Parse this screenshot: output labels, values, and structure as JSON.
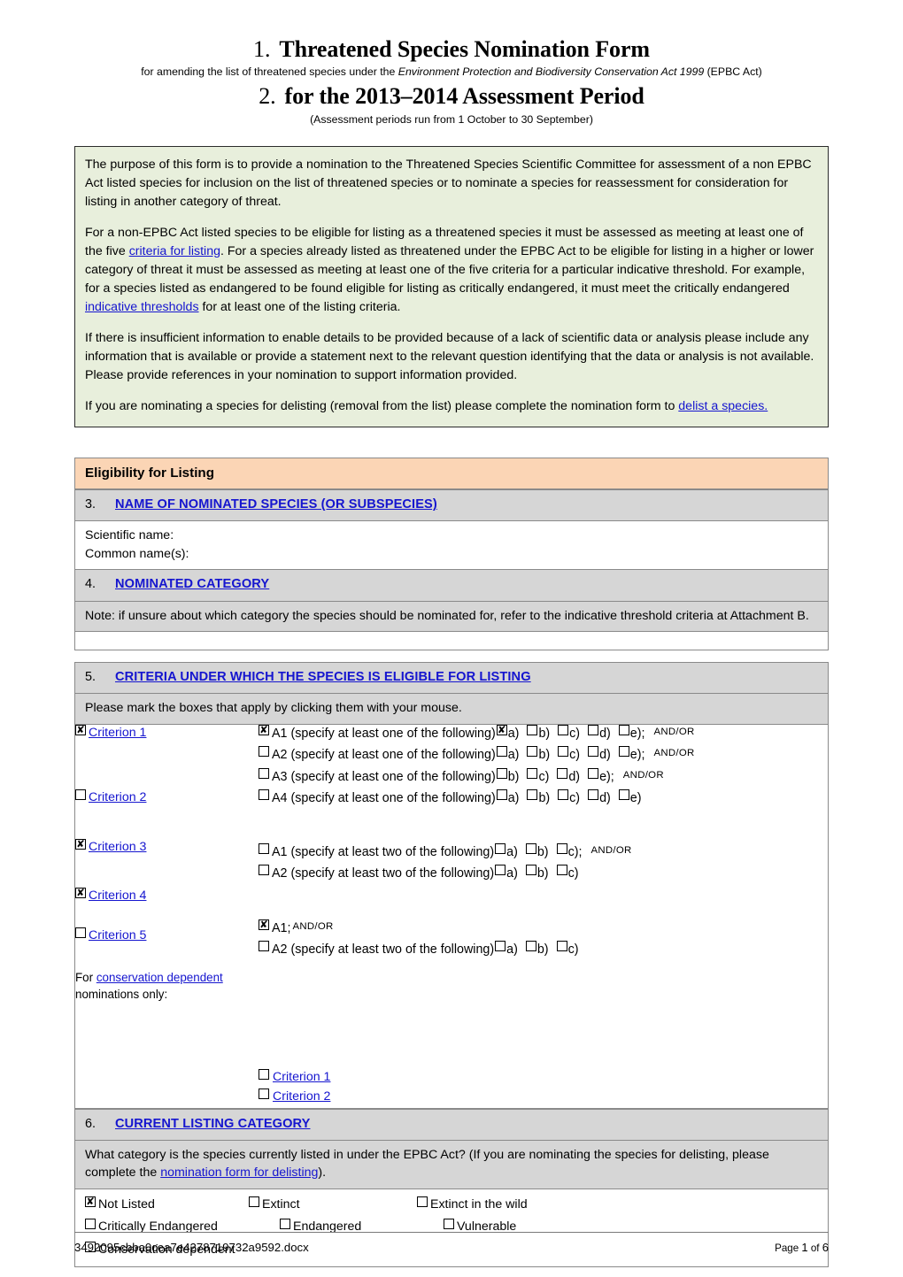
{
  "document": {
    "title_1_number": "1.",
    "title_1": "Threatened Species Nomination Form",
    "subtitle_1_pre": "for amending the list of threatened species under the ",
    "subtitle_1_italic": "Environment Protection and Biodiversity Conservation Act 1999",
    "subtitle_1_post": " (EPBC Act)",
    "title_2_number": "2.",
    "title_2": "for the 2013–2014 Assessment Period",
    "subtitle_2": "(Assessment periods run from 1 October to 30 September)"
  },
  "intro": {
    "para1": "The purpose of this form is to provide a nomination to the Threatened Species Scientific Committee for assessment of a non EPBC Act listed species for inclusion on the list of threatened species or to nominate a species for reassessment for consideration for listing in another category of threat.",
    "para2_a": "For a non-EPBC Act listed species to be eligible for listing as a threatened species it must be assessed as meeting at least one of the five ",
    "para2_link1": "criteria for listing",
    "para2_b": ". For a species already listed as threatened under the EPBC Act to be eligible for listing in a higher or lower category of threat it must be assessed as meeting at least one of the five criteria for a particular indicative threshold. For example, for a species listed as endangered to be found eligible for listing as critically endangered, it must meet the critically endangered ",
    "para2_link2": "indicative thresholds",
    "para2_c": " for at least one of the listing criteria.",
    "para3": "If there is insufficient information to enable details to be provided because of a lack of scientific data or analysis please include any information that is available or provide a statement next to the relevant question identifying that the data or analysis is not available. Please provide references in your nomination to support information provided.",
    "para4_a": "If you are nominating a species for delisting (removal from the list) please complete the nomination form to ",
    "para4_link": "delist a species.",
    "background_color": "#E8EFDC"
  },
  "eligibility_header": {
    "label": "Eligibility for Listing",
    "background_color": "#FBD5B5"
  },
  "section3": {
    "number": "3.",
    "heading": "NAME OF NOMINATED SPECIES (OR SUBSPECIES)",
    "field_scientific_name": "Scientific name:",
    "field_common_name": "Common name(s):",
    "scientific_name_value": "",
    "common_name_value": ""
  },
  "section4": {
    "number": "4.",
    "heading": "NOMINATED CATEGORY",
    "note": "Note: if unsure about which category the species should be nominated for, refer to the indicative threshold criteria at Attachment B."
  },
  "section5": {
    "number": "5.",
    "heading": "CRITERIA UNDER WHICH THE SPECIES IS ELIGIBLE FOR LISTING",
    "instruction": "Please mark the boxes that apply by clicking them with your mouse.",
    "criteria": [
      {
        "label": "Criterion 1",
        "checked": true,
        "rows": [
          {
            "checked": true,
            "text": "A1 (specify at least one of the following)",
            "subs": [
              {
                "label": "a)",
                "checked": true
              },
              {
                "label": "b)",
                "checked": false
              },
              {
                "label": "c)",
                "checked": false
              },
              {
                "label": "d)",
                "checked": false
              },
              {
                "label": "e);",
                "checked": false
              }
            ],
            "suffix": "AND/OR"
          },
          {
            "checked": false,
            "text": "A2 (specify at least one of the following)",
            "subs": [
              {
                "label": "a)",
                "checked": false
              },
              {
                "label": "b)",
                "checked": false
              },
              {
                "label": "c)",
                "checked": false
              },
              {
                "label": "d)",
                "checked": false
              },
              {
                "label": "e);",
                "checked": false
              }
            ],
            "suffix": "AND/OR"
          },
          {
            "checked": false,
            "text": "A3 (specify at least one of the following)",
            "subs": [
              {
                "label": "b)",
                "checked": false
              },
              {
                "label": "c)",
                "checked": false
              },
              {
                "label": "d)",
                "checked": false
              },
              {
                "label": "e);",
                "checked": false
              }
            ],
            "suffix": "AND/OR"
          },
          {
            "checked": false,
            "text": "A4 (specify at least one of the following)",
            "subs": [
              {
                "label": "a)",
                "checked": false
              },
              {
                "label": "b)",
                "checked": false
              },
              {
                "label": "c)",
                "checked": false
              },
              {
                "label": "d)",
                "checked": false
              },
              {
                "label": "e)",
                "checked": false
              }
            ],
            "suffix": ""
          }
        ]
      },
      {
        "label": "Criterion 2",
        "checked": false,
        "rows": [
          {
            "checked": false,
            "text": "A1 (specify at least two of the following)",
            "subs": [
              {
                "label": "a)",
                "checked": false
              },
              {
                "label": "b)",
                "checked": false
              },
              {
                "label": "c);",
                "checked": false
              }
            ],
            "suffix": "AND/OR"
          },
          {
            "checked": false,
            "text": "A2 (specify at least two of the following)",
            "subs": [
              {
                "label": "a)",
                "checked": false
              },
              {
                "label": "b)",
                "checked": false
              },
              {
                "label": "c)",
                "checked": false
              }
            ],
            "suffix": ""
          }
        ]
      },
      {
        "label": "Criterion 3",
        "checked": true,
        "rows": [
          {
            "checked": true,
            "text": "A1;",
            "subs": [],
            "suffix": "AND/OR"
          },
          {
            "checked": false,
            "text": "A2 (specify at least two of the following)",
            "subs": [
              {
                "label": "a)",
                "checked": false
              },
              {
                "label": "b)",
                "checked": false
              },
              {
                "label": "c)",
                "checked": false
              }
            ],
            "suffix": ""
          }
        ]
      },
      {
        "label": "Criterion 4",
        "checked": true,
        "rows": []
      },
      {
        "label": "Criterion 5",
        "checked": false,
        "rows": []
      }
    ],
    "conservation_dependent": {
      "prefix": "For ",
      "link": "conservation dependent",
      "suffix": " nominations only:",
      "options": [
        {
          "label": "Criterion 1",
          "checked": false
        },
        {
          "label": "Criterion 2",
          "checked": false
        }
      ]
    }
  },
  "section6": {
    "number": "6.",
    "heading": "CURRENT LISTING CATEGORY",
    "question_a": "What category is the species currently listed in under the EPBC Act? (If you are nominating the species for delisting, please complete the ",
    "question_link": "nomination form for delisting",
    "question_b": ").",
    "categories": [
      {
        "label": "Not Listed",
        "checked": true
      },
      {
        "label": "Extinct",
        "checked": false
      },
      {
        "label": "Extinct in the wild",
        "checked": false
      },
      {
        "label": "Critically Endangered",
        "checked": false
      },
      {
        "label": "Endangered",
        "checked": false
      },
      {
        "label": "Vulnerable",
        "checked": false
      },
      {
        "label": "Conservation dependent",
        "checked": false
      }
    ]
  },
  "footer": {
    "filename": "3492095cbba0cea7e4278719732a9592.docx",
    "page_prefix": "Page ",
    "page_current": "1",
    "page_of": " of ",
    "page_total": "6"
  },
  "colors": {
    "link": "#1515CF",
    "intro_bg": "#E8EFDC",
    "header_bg": "#FBD5B5",
    "row_bg": "#D6D6D6"
  }
}
